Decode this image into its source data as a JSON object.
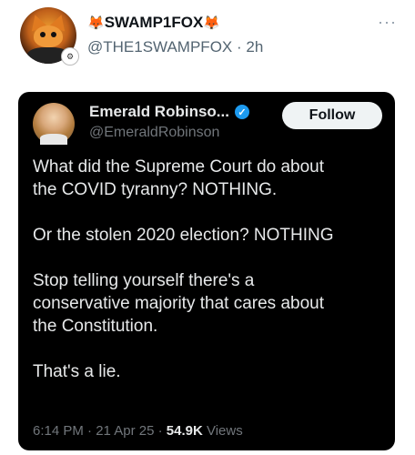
{
  "post": {
    "display_name": "SWAMP1FOX",
    "name_emoji_left": "🦊",
    "name_emoji_right": "🦊",
    "handle": "@THE1SWAMPFOX",
    "separator": " · ",
    "time": "2h",
    "more_label": "···",
    "avatar_icon": "fox-avatar-icon",
    "badge_icon": "seal-badge-icon"
  },
  "quoted": {
    "display_name": "Emerald Robinso...",
    "verified_icon": "verified-check-icon",
    "verified_glyph": "✓",
    "handle": "@EmeraldRobinson",
    "follow_label": "Follow",
    "text": "What did the Supreme Court do about\nthe COVID tyranny? NOTHING.\n\nOr the stolen 2020 election? NOTHING\n\nStop telling yourself there's a\nconservative majority that cares about\nthe Constitution.\n\nThat's a lie.",
    "time": "6:14 PM",
    "date": "21 Apr 25",
    "dot": " · ",
    "views_count": "54.9K",
    "views_label": " Views"
  },
  "colors": {
    "card_background": "#000000",
    "verified_blue": "#1d9bf0",
    "follow_bg": "#eff3f4"
  }
}
